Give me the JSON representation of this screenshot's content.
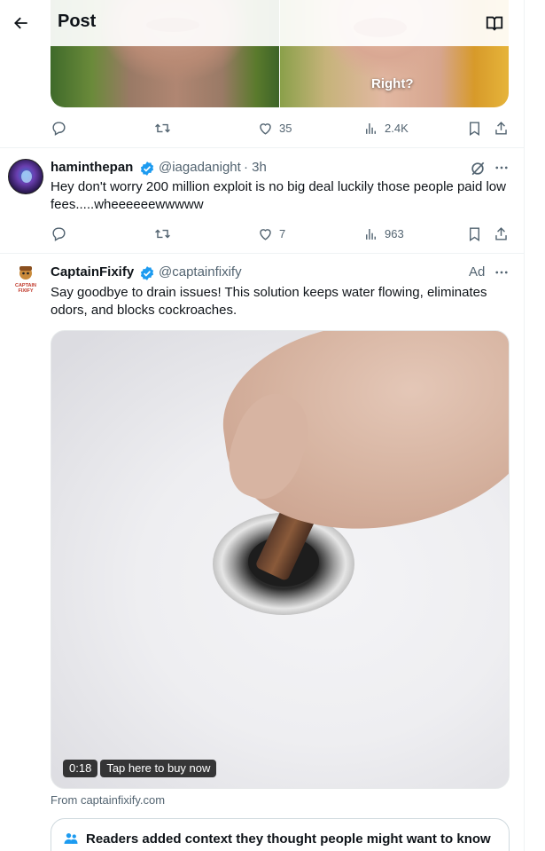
{
  "header": {
    "title": "Post"
  },
  "top_post": {
    "caption": "Right?",
    "stats": {
      "likes": "35",
      "views": "2.4K"
    }
  },
  "reply": {
    "display_name": "haminthepan",
    "handle": "@iagadanight",
    "time": "· 3h",
    "text": "Hey don't worry 200 million exploit is no big deal luckily those people paid low fees.....wheeeeeewwwww",
    "stats": {
      "likes": "7",
      "views": "963"
    }
  },
  "ad": {
    "display_name": "CaptainFixify",
    "handle": "@captainfixify",
    "ad_label": "Ad",
    "avatar_text": "CAPTAIN FIXIFY",
    "text": "Say goodbye to drain issues! This solution keeps water flowing, eliminates odors, and blocks cockroaches.",
    "video": {
      "duration": "0:18",
      "cta": "Tap here to buy now"
    },
    "source": "From captainfixify.com",
    "context_note": "Readers added context they thought people might want to know"
  },
  "colors": {
    "accent": "#1d9bf0",
    "secondary_text": "#536471",
    "primary_text": "#0f1419"
  },
  "icons": [
    "back-arrow-icon",
    "reader-mode-icon",
    "reply-icon",
    "retweet-icon",
    "like-icon",
    "views-icon",
    "bookmark-icon",
    "share-icon",
    "verified-icon",
    "grok-icon",
    "more-icon",
    "people-icon"
  ]
}
